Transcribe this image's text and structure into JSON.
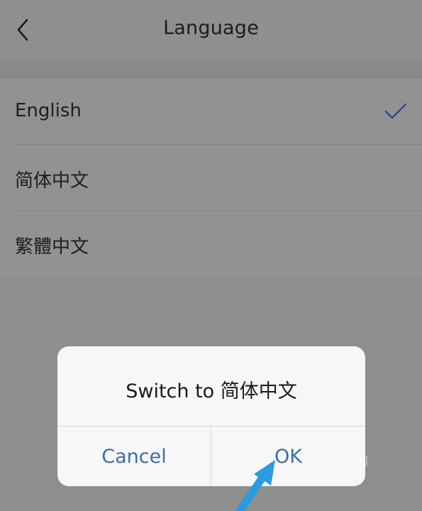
{
  "header": {
    "title": "Language",
    "back_icon": "chevron-left-icon"
  },
  "languages": [
    {
      "label": "English",
      "selected": true
    },
    {
      "label": "简体中文",
      "selected": false
    },
    {
      "label": "繁體中文",
      "selected": false
    }
  ],
  "dialog": {
    "message": "Switch to 简体中文",
    "cancel_label": "Cancel",
    "ok_label": "OK"
  },
  "colors": {
    "accent": "#3a6fa8",
    "checkmark": "#2f4b8a",
    "pointer_arrow": "#2a9be0"
  },
  "watermark": {
    "text": "游网"
  }
}
